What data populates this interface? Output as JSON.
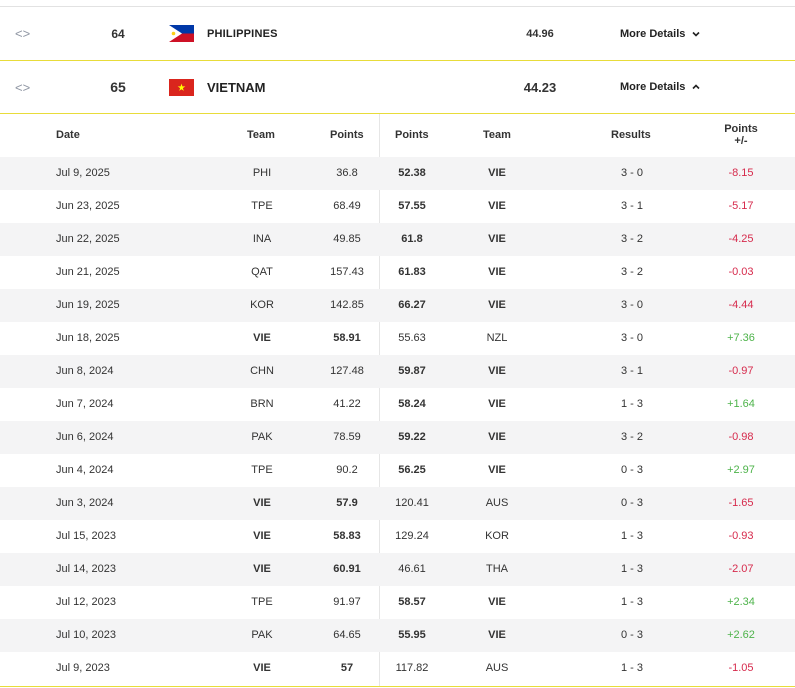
{
  "rankings": [
    {
      "rank": "64",
      "country": "PHILIPPINES",
      "score": "44.96",
      "more": "More Details",
      "expanded": false
    },
    {
      "rank": "65",
      "country": "VIETNAM",
      "score": "44.23",
      "more": "More Details",
      "expanded": true
    }
  ],
  "table": {
    "headers": {
      "date": "Date",
      "team1": "Team",
      "points1": "Points",
      "points2": "Points",
      "team2": "Team",
      "results": "Results",
      "diff_line1": "Points",
      "diff_line2": "+/-"
    },
    "rows": [
      {
        "date": "Jul 9, 2025",
        "team1": "PHI",
        "pts1": "36.8",
        "pts2": "52.38",
        "team2": "VIE",
        "result": "3 - 0",
        "diff": "-8.15"
      },
      {
        "date": "Jun 23, 2025",
        "team1": "TPE",
        "pts1": "68.49",
        "pts2": "57.55",
        "team2": "VIE",
        "result": "3 - 1",
        "diff": "-5.17"
      },
      {
        "date": "Jun 22, 2025",
        "team1": "INA",
        "pts1": "49.85",
        "pts2": "61.8",
        "team2": "VIE",
        "result": "3 - 2",
        "diff": "-4.25"
      },
      {
        "date": "Jun 21, 2025",
        "team1": "QAT",
        "pts1": "157.43",
        "pts2": "61.83",
        "team2": "VIE",
        "result": "3 - 2",
        "diff": "-0.03"
      },
      {
        "date": "Jun 19, 2025",
        "team1": "KOR",
        "pts1": "142.85",
        "pts2": "66.27",
        "team2": "VIE",
        "result": "3 - 0",
        "diff": "-4.44"
      },
      {
        "date": "Jun 18, 2025",
        "team1": "VIE",
        "pts1": "58.91",
        "pts2": "55.63",
        "team2": "NZL",
        "result": "3 - 0",
        "diff": "+7.36"
      },
      {
        "date": "Jun 8, 2024",
        "team1": "CHN",
        "pts1": "127.48",
        "pts2": "59.87",
        "team2": "VIE",
        "result": "3 - 1",
        "diff": "-0.97"
      },
      {
        "date": "Jun 7, 2024",
        "team1": "BRN",
        "pts1": "41.22",
        "pts2": "58.24",
        "team2": "VIE",
        "result": "1 - 3",
        "diff": "+1.64"
      },
      {
        "date": "Jun 6, 2024",
        "team1": "PAK",
        "pts1": "78.59",
        "pts2": "59.22",
        "team2": "VIE",
        "result": "3 - 2",
        "diff": "-0.98"
      },
      {
        "date": "Jun 4, 2024",
        "team1": "TPE",
        "pts1": "90.2",
        "pts2": "56.25",
        "team2": "VIE",
        "result": "0 - 3",
        "diff": "+2.97"
      },
      {
        "date": "Jun 3, 2024",
        "team1": "VIE",
        "pts1": "57.9",
        "pts2": "120.41",
        "team2": "AUS",
        "result": "0 - 3",
        "diff": "-1.65"
      },
      {
        "date": "Jul 15, 2023",
        "team1": "VIE",
        "pts1": "58.83",
        "pts2": "129.24",
        "team2": "KOR",
        "result": "1 - 3",
        "diff": "-0.93"
      },
      {
        "date": "Jul 14, 2023",
        "team1": "VIE",
        "pts1": "60.91",
        "pts2": "46.61",
        "team2": "THA",
        "result": "1 - 3",
        "diff": "-2.07"
      },
      {
        "date": "Jul 12, 2023",
        "team1": "TPE",
        "pts1": "91.97",
        "pts2": "58.57",
        "team2": "VIE",
        "result": "1 - 3",
        "diff": "+2.34"
      },
      {
        "date": "Jul 10, 2023",
        "team1": "PAK",
        "pts1": "64.65",
        "pts2": "55.95",
        "team2": "VIE",
        "result": "0 - 3",
        "diff": "+2.62"
      },
      {
        "date": "Jul 9, 2023",
        "team1": "VIE",
        "pts1": "57",
        "pts2": "117.82",
        "team2": "AUS",
        "result": "1 - 3",
        "diff": "-1.05"
      }
    ]
  },
  "colors": {
    "accent_line": "#e8dc3a",
    "negative": "#d62a4c",
    "positive": "#4db34a",
    "row_shade": "#f4f4f5"
  },
  "icons": {
    "drag": "code-arrows-icon",
    "collapsed": "chevron-down-icon",
    "expanded": "chevron-up-icon"
  }
}
